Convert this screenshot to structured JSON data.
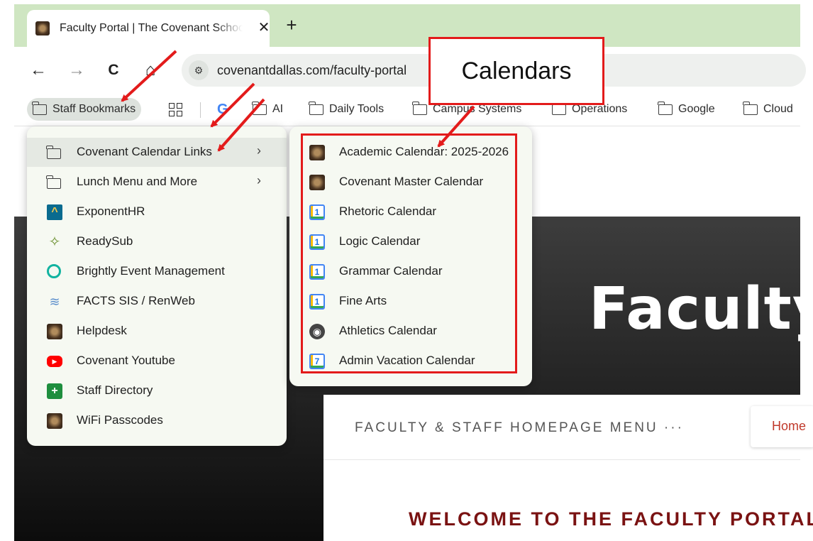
{
  "browser": {
    "tab": {
      "title": "Faculty Portal | The Covenant School",
      "favicon": "covenant-seal-icon",
      "close_symbol": "✕"
    },
    "new_tab_symbol": "+",
    "nav": {
      "back": "←",
      "forward": "→",
      "reload": "C",
      "home": "⌂"
    },
    "omnibox": {
      "site_info_symbol": "⚙",
      "url": "covenantdallas.com/faculty-portal"
    }
  },
  "bookmarks_bar": {
    "items": [
      {
        "label": "Staff Bookmarks",
        "icon": "folder-icon"
      },
      {
        "label": "",
        "icon": "apps-icon"
      },
      {
        "label": "G",
        "icon": "google-icon"
      },
      {
        "label": "AI",
        "icon": "folder-icon"
      },
      {
        "label": "Daily Tools",
        "icon": "folder-icon"
      },
      {
        "label": "Campus Systems",
        "icon": "folder-icon"
      },
      {
        "label": "Operations",
        "icon": "folder-icon"
      },
      {
        "label": "Google",
        "icon": "folder-icon"
      },
      {
        "label": "Cloud",
        "icon": "folder-icon"
      }
    ]
  },
  "staff_menu": {
    "items": [
      {
        "label": "Covenant Calendar Links",
        "icon": "folder-icon",
        "submenu": true
      },
      {
        "label": "Lunch Menu and More",
        "icon": "folder-icon",
        "submenu": true
      },
      {
        "label": "ExponentHR",
        "icon": "exponenthr-icon"
      },
      {
        "label": "ReadySub",
        "icon": "readysub-icon"
      },
      {
        "label": "Brightly Event Management",
        "icon": "brightly-icon"
      },
      {
        "label": "FACTS SIS / RenWeb",
        "icon": "facts-icon"
      },
      {
        "label": "Helpdesk",
        "icon": "covenant-seal-icon"
      },
      {
        "label": "Covenant Youtube",
        "icon": "youtube-icon"
      },
      {
        "label": "Staff Directory",
        "icon": "directory-icon"
      },
      {
        "label": "WiFi Passcodes",
        "icon": "covenant-seal-icon"
      }
    ],
    "chevron": "›"
  },
  "calendar_menu": {
    "items": [
      {
        "label": "Academic Calendar: 2025-2026",
        "icon": "covenant-seal-icon"
      },
      {
        "label": "Covenant Master Calendar",
        "icon": "covenant-seal-icon"
      },
      {
        "label": "Rhetoric Calendar",
        "icon": "google-calendar-icon",
        "glyph": "1"
      },
      {
        "label": "Logic Calendar",
        "icon": "google-calendar-icon",
        "glyph": "1"
      },
      {
        "label": "Grammar Calendar",
        "icon": "google-calendar-icon",
        "glyph": "1"
      },
      {
        "label": "Fine Arts",
        "icon": "google-calendar-icon",
        "glyph": "1"
      },
      {
        "label": "Athletics Calendar",
        "icon": "globe-icon"
      },
      {
        "label": "Admin Vacation Calendar",
        "icon": "google-calendar-icon",
        "glyph": "7"
      }
    ]
  },
  "page": {
    "hero_title": "Faculty",
    "menu_label": "FACULTY & STAFF HOMEPAGE MENU ···",
    "home_link": "Home",
    "welcome": "WELCOME TO THE FACULTY PORTAL"
  },
  "annotation": {
    "callout_text": "Calendars",
    "color": "#e31b1b"
  }
}
